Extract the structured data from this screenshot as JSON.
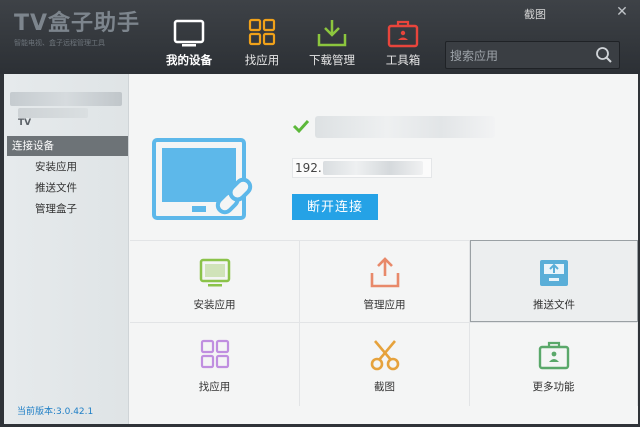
{
  "app": {
    "logo_title": "TV盒子助手",
    "logo_subtitle": "智能电视、盒子远程管理工具",
    "window_title": "截图",
    "close_symbol": "✕"
  },
  "nav": {
    "tabs": [
      {
        "label": "我的设备",
        "icon": "monitor-icon",
        "active": true
      },
      {
        "label": "找应用",
        "icon": "grid-icon",
        "active": false
      },
      {
        "label": "下载管理",
        "icon": "download-icon",
        "active": false
      },
      {
        "label": "工具箱",
        "icon": "toolbox-icon",
        "active": false
      }
    ]
  },
  "search": {
    "placeholder": "搜索应用",
    "value": ""
  },
  "sidebar": {
    "brand_mark": "TV",
    "items": [
      {
        "label": "连接设备",
        "active": true
      },
      {
        "label": "安装应用",
        "active": false
      },
      {
        "label": "推送文件",
        "active": false
      },
      {
        "label": "管理盒子",
        "active": false
      }
    ],
    "version": "当前版本:3.0.42.1"
  },
  "device": {
    "ip_prefix": "192.",
    "disconnect_label": "断开连接"
  },
  "tiles": [
    {
      "label": "安装应用",
      "icon": "tv-install-icon"
    },
    {
      "label": "管理应用",
      "icon": "upload-icon"
    },
    {
      "label": "推送文件",
      "icon": "inbox-push-icon",
      "selected": true
    },
    {
      "label": "找应用",
      "icon": "grid-icon"
    },
    {
      "label": "截图",
      "icon": "scissors-icon"
    },
    {
      "label": "更多功能",
      "icon": "toolbox-icon"
    }
  ],
  "colors": {
    "accent": "#25a2e6",
    "nav_monitor": "#ffffff",
    "nav_grid": "#f0a11a",
    "nav_download": "#8cc63e",
    "nav_toolbox": "#e8453c",
    "tile_green": "#8bc34a",
    "tile_orange": "#e8896a",
    "tile_blue": "#5aaed8",
    "tile_purple": "#c08fe0",
    "tile_scissors": "#e6a23c",
    "tile_teal": "#5aa86a",
    "check": "#5cb83a"
  }
}
